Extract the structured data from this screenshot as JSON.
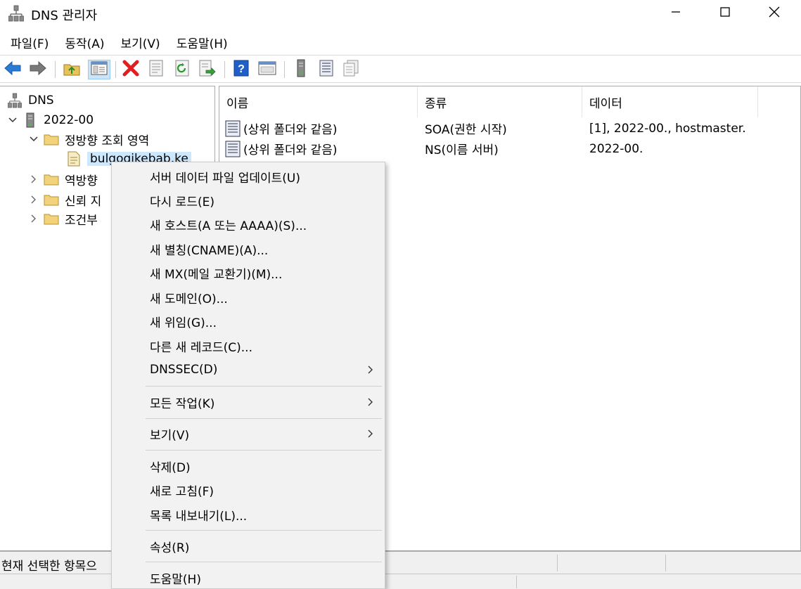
{
  "window": {
    "title": "DNS 관리자",
    "icons": {
      "app": "dns-server-icon",
      "minimize": "minimize-icon",
      "maximize": "maximize-icon",
      "close": "close-icon"
    }
  },
  "menubar": {
    "items": [
      "파일(F)",
      "동작(A)",
      "보기(V)",
      "도움말(H)"
    ]
  },
  "toolbar": {
    "buttons": [
      "back-arrow-icon",
      "forward-arrow-icon",
      "up-folder-icon",
      "show-hide-console-tree-icon",
      "delete-icon",
      "properties-icon",
      "refresh-icon",
      "export-list-icon",
      "help-icon",
      "show-console-icon",
      "server-icon",
      "list-view-icon",
      "copy-view-icon"
    ]
  },
  "tree": {
    "root": "DNS",
    "server": "2022-00",
    "forward_zones": "정방향 조회 영역",
    "selected_zone": "bulgogikebab.ke",
    "reverse_zones": "역방향",
    "trust_points": "신뢰 지",
    "conditional": "조건부"
  },
  "list": {
    "columns": [
      "이름",
      "종류",
      "데이터"
    ],
    "rows": [
      {
        "name": "(상위 폴더와 같음)",
        "type": "SOA(권한 시작)",
        "data": "[1], 2022-00., hostmaster."
      },
      {
        "name": "(상위 폴더와 같음)",
        "type": "NS(이름 서버)",
        "data": "2022-00."
      }
    ]
  },
  "status": {
    "text": "현재 선택한 항목으"
  },
  "context_menu": {
    "items": [
      {
        "label": "서버 데이터 파일 업데이트(U)",
        "submenu": false
      },
      {
        "label": "다시 로드(E)",
        "submenu": false
      },
      {
        "label": "새 호스트(A 또는 AAAA)(S)...",
        "submenu": false
      },
      {
        "label": "새 별칭(CNAME)(A)...",
        "submenu": false
      },
      {
        "label": "새 MX(메일 교환기)(M)...",
        "submenu": false
      },
      {
        "label": "새 도메인(O)...",
        "submenu": false
      },
      {
        "label": "새 위임(G)...",
        "submenu": false
      },
      {
        "label": "다른 새 레코드(C)...",
        "submenu": false
      },
      {
        "label": "DNSSEC(D)",
        "submenu": true
      },
      {
        "label": "모든 작업(K)",
        "submenu": true
      },
      {
        "label": "보기(V)",
        "submenu": true
      },
      {
        "label": "삭제(D)",
        "submenu": false
      },
      {
        "label": "새로 고침(F)",
        "submenu": false
      },
      {
        "label": "목록 내보내기(L)...",
        "submenu": false
      },
      {
        "label": "속성(R)",
        "submenu": false
      },
      {
        "label": "도움말(H)",
        "submenu": false
      }
    ]
  },
  "colors": {
    "selection": "#cce8ff",
    "menu_bg": "#f2f2f2",
    "accent_blue": "#1e78d2",
    "delete_red": "#e02020"
  }
}
